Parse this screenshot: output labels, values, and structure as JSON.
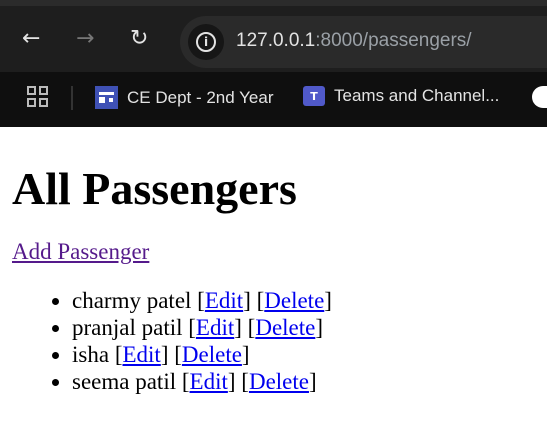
{
  "browser": {
    "url_host": "127.0.0.1",
    "url_rest": ":8000/passengers/",
    "bookmarks": [
      {
        "label": "CE Dept - 2nd Year"
      },
      {
        "label": "Teams and Channel..."
      }
    ]
  },
  "page": {
    "title": "All Passengers",
    "add_link": "Add Passenger",
    "edit_label": "Edit",
    "delete_label": "Delete",
    "passengers": [
      {
        "name": "charmy patel"
      },
      {
        "name": "pranjal patil"
      },
      {
        "name": "isha"
      },
      {
        "name": "seema patil"
      }
    ]
  }
}
